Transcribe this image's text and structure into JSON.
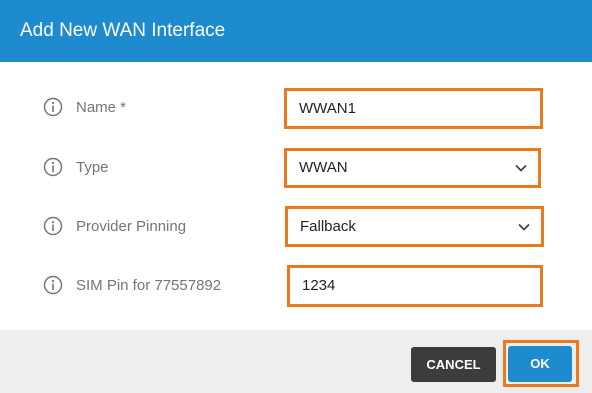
{
  "dialog": {
    "title": "Add New WAN Interface"
  },
  "fields": {
    "name": {
      "label": "Name *",
      "value": "WWAN1"
    },
    "type": {
      "label": "Type",
      "value": "WWAN"
    },
    "provider_pinning": {
      "label": "Provider Pinning",
      "value": "Fallback"
    },
    "sim_pin": {
      "label": "SIM Pin for 77557892",
      "value": "1234"
    }
  },
  "buttons": {
    "cancel": "CANCEL",
    "ok": "OK"
  },
  "icons": {
    "info": "info-circle-icon",
    "dropdown": "chevron-down-icon"
  },
  "colors": {
    "accent": "#1e8bcf",
    "highlight": "#ec7a1c",
    "cancel_bg": "#3c3c3c",
    "footer_bg": "#eeeeee"
  }
}
